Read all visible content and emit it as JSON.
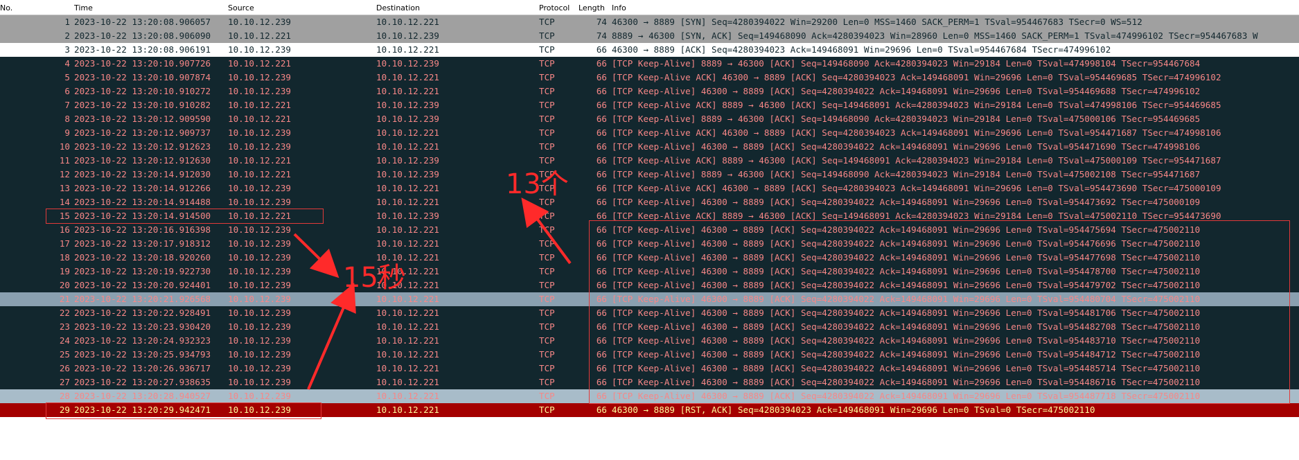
{
  "columns": {
    "no": "No.",
    "time": "Time",
    "source": "Source",
    "destination": "Destination",
    "protocol": "Protocol",
    "length": "Length",
    "info": "Info"
  },
  "packets": [
    {
      "no": "1",
      "time": "2023-10-22 13:20:08.906057",
      "src": "10.10.12.239",
      "dst": "10.10.12.221",
      "proto": "TCP",
      "len": "74",
      "info": "46300 → 8889 [SYN] Seq=4280394022 Win=29200 Len=0 MSS=1460 SACK_PERM=1 TSval=954467683 TSecr=0 WS=512",
      "style": "syn"
    },
    {
      "no": "2",
      "time": "2023-10-22 13:20:08.906090",
      "src": "10.10.12.221",
      "dst": "10.10.12.239",
      "proto": "TCP",
      "len": "74",
      "info": "8889 → 46300 [SYN, ACK] Seq=149468090 Ack=4280394023 Win=28960 Len=0 MSS=1460 SACK_PERM=1 TSval=474996102 TSecr=954467683 W",
      "style": "syn"
    },
    {
      "no": "3",
      "time": "2023-10-22 13:20:08.906191",
      "src": "10.10.12.239",
      "dst": "10.10.12.221",
      "proto": "TCP",
      "len": "66",
      "info": "46300 → 8889 [ACK] Seq=4280394023 Ack=149468091 Win=29696 Len=0 TSval=954467684 TSecr=474996102",
      "style": "sel"
    },
    {
      "no": "4",
      "time": "2023-10-22 13:20:10.907726",
      "src": "10.10.12.221",
      "dst": "10.10.12.239",
      "proto": "TCP",
      "len": "66",
      "info": "[TCP Keep-Alive] 8889 → 46300 [ACK] Seq=149468090 Ack=4280394023 Win=29184 Len=0 TSval=474998104 TSecr=954467684",
      "style": "ka"
    },
    {
      "no": "5",
      "time": "2023-10-22 13:20:10.907874",
      "src": "10.10.12.239",
      "dst": "10.10.12.221",
      "proto": "TCP",
      "len": "66",
      "info": "[TCP Keep-Alive ACK] 46300 → 8889 [ACK] Seq=4280394023 Ack=149468091 Win=29696 Len=0 TSval=954469685 TSecr=474996102",
      "style": "ka"
    },
    {
      "no": "6",
      "time": "2023-10-22 13:20:10.910272",
      "src": "10.10.12.239",
      "dst": "10.10.12.221",
      "proto": "TCP",
      "len": "66",
      "info": "[TCP Keep-Alive] 46300 → 8889 [ACK] Seq=4280394022 Ack=149468091 Win=29696 Len=0 TSval=954469688 TSecr=474996102",
      "style": "ka"
    },
    {
      "no": "7",
      "time": "2023-10-22 13:20:10.910282",
      "src": "10.10.12.221",
      "dst": "10.10.12.239",
      "proto": "TCP",
      "len": "66",
      "info": "[TCP Keep-Alive ACK] 8889 → 46300 [ACK] Seq=149468091 Ack=4280394023 Win=29184 Len=0 TSval=474998106 TSecr=954469685",
      "style": "ka"
    },
    {
      "no": "8",
      "time": "2023-10-22 13:20:12.909590",
      "src": "10.10.12.221",
      "dst": "10.10.12.239",
      "proto": "TCP",
      "len": "66",
      "info": "[TCP Keep-Alive] 8889 → 46300 [ACK] Seq=149468090 Ack=4280394023 Win=29184 Len=0 TSval=475000106 TSecr=954469685",
      "style": "ka"
    },
    {
      "no": "9",
      "time": "2023-10-22 13:20:12.909737",
      "src": "10.10.12.239",
      "dst": "10.10.12.221",
      "proto": "TCP",
      "len": "66",
      "info": "[TCP Keep-Alive ACK] 46300 → 8889 [ACK] Seq=4280394023 Ack=149468091 Win=29696 Len=0 TSval=954471687 TSecr=474998106",
      "style": "ka"
    },
    {
      "no": "10",
      "time": "2023-10-22 13:20:12.912623",
      "src": "10.10.12.239",
      "dst": "10.10.12.221",
      "proto": "TCP",
      "len": "66",
      "info": "[TCP Keep-Alive] 46300 → 8889 [ACK] Seq=4280394022 Ack=149468091 Win=29696 Len=0 TSval=954471690 TSecr=474998106",
      "style": "ka"
    },
    {
      "no": "11",
      "time": "2023-10-22 13:20:12.912630",
      "src": "10.10.12.221",
      "dst": "10.10.12.239",
      "proto": "TCP",
      "len": "66",
      "info": "[TCP Keep-Alive ACK] 8889 → 46300 [ACK] Seq=149468091 Ack=4280394023 Win=29184 Len=0 TSval=475000109 TSecr=954471687",
      "style": "ka"
    },
    {
      "no": "12",
      "time": "2023-10-22 13:20:14.912030",
      "src": "10.10.12.221",
      "dst": "10.10.12.239",
      "proto": "TCP",
      "len": "66",
      "info": "[TCP Keep-Alive] 8889 → 46300 [ACK] Seq=149468090 Ack=4280394023 Win=29184 Len=0 TSval=475002108 TSecr=954471687",
      "style": "ka"
    },
    {
      "no": "13",
      "time": "2023-10-22 13:20:14.912266",
      "src": "10.10.12.239",
      "dst": "10.10.12.221",
      "proto": "TCP",
      "len": "66",
      "info": "[TCP Keep-Alive ACK] 46300 → 8889 [ACK] Seq=4280394023 Ack=149468091 Win=29696 Len=0 TSval=954473690 TSecr=475000109",
      "style": "ka"
    },
    {
      "no": "14",
      "time": "2023-10-22 13:20:14.914488",
      "src": "10.10.12.239",
      "dst": "10.10.12.221",
      "proto": "TCP",
      "len": "66",
      "info": "[TCP Keep-Alive] 46300 → 8889 [ACK] Seq=4280394022 Ack=149468091 Win=29696 Len=0 TSval=954473692 TSecr=475000109",
      "style": "ka"
    },
    {
      "no": "15",
      "time": "2023-10-22 13:20:14.914500",
      "src": "10.10.12.221",
      "dst": "10.10.12.239",
      "proto": "TCP",
      "len": "66",
      "info": "[TCP Keep-Alive ACK] 8889 → 46300 [ACK] Seq=149468091 Ack=4280394023 Win=29184 Len=0 TSval=475002110 TSecr=954473690",
      "style": "ka"
    },
    {
      "no": "16",
      "time": "2023-10-22 13:20:16.916398",
      "src": "10.10.12.239",
      "dst": "10.10.12.221",
      "proto": "TCP",
      "len": "66",
      "info": "[TCP Keep-Alive] 46300 → 8889 [ACK] Seq=4280394022 Ack=149468091 Win=29696 Len=0 TSval=954475694 TSecr=475002110",
      "style": "ka"
    },
    {
      "no": "17",
      "time": "2023-10-22 13:20:17.918312",
      "src": "10.10.12.239",
      "dst": "10.10.12.221",
      "proto": "TCP",
      "len": "66",
      "info": "[TCP Keep-Alive] 46300 → 8889 [ACK] Seq=4280394022 Ack=149468091 Win=29696 Len=0 TSval=954476696 TSecr=475002110",
      "style": "ka"
    },
    {
      "no": "18",
      "time": "2023-10-22 13:20:18.920260",
      "src": "10.10.12.239",
      "dst": "10.10.12.221",
      "proto": "TCP",
      "len": "66",
      "info": "[TCP Keep-Alive] 46300 → 8889 [ACK] Seq=4280394022 Ack=149468091 Win=29696 Len=0 TSval=954477698 TSecr=475002110",
      "style": "ka"
    },
    {
      "no": "19",
      "time": "2023-10-22 13:20:19.922730",
      "src": "10.10.12.239",
      "dst": "10.10.12.221",
      "proto": "TCP",
      "len": "66",
      "info": "[TCP Keep-Alive] 46300 → 8889 [ACK] Seq=4280394022 Ack=149468091 Win=29696 Len=0 TSval=954478700 TSecr=475002110",
      "style": "ka"
    },
    {
      "no": "20",
      "time": "2023-10-22 13:20:20.924401",
      "src": "10.10.12.239",
      "dst": "10.10.12.221",
      "proto": "TCP",
      "len": "66",
      "info": "[TCP Keep-Alive] 46300 → 8889 [ACK] Seq=4280394022 Ack=149468091 Win=29696 Len=0 TSval=954479702 TSecr=475002110",
      "style": "ka"
    },
    {
      "no": "21",
      "time": "2023-10-22 13:20:21.926568",
      "src": "10.10.12.239",
      "dst": "10.10.12.221",
      "proto": "TCP",
      "len": "66",
      "info": "[TCP Keep-Alive] 46300 → 8889 [ACK] Seq=4280394022 Ack=149468091 Win=29696 Len=0 TSval=954480704 TSecr=475002110",
      "style": "hl-mid"
    },
    {
      "no": "22",
      "time": "2023-10-22 13:20:22.928491",
      "src": "10.10.12.239",
      "dst": "10.10.12.221",
      "proto": "TCP",
      "len": "66",
      "info": "[TCP Keep-Alive] 46300 → 8889 [ACK] Seq=4280394022 Ack=149468091 Win=29696 Len=0 TSval=954481706 TSecr=475002110",
      "style": "ka"
    },
    {
      "no": "23",
      "time": "2023-10-22 13:20:23.930420",
      "src": "10.10.12.239",
      "dst": "10.10.12.221",
      "proto": "TCP",
      "len": "66",
      "info": "[TCP Keep-Alive] 46300 → 8889 [ACK] Seq=4280394022 Ack=149468091 Win=29696 Len=0 TSval=954482708 TSecr=475002110",
      "style": "ka"
    },
    {
      "no": "24",
      "time": "2023-10-22 13:20:24.932323",
      "src": "10.10.12.239",
      "dst": "10.10.12.221",
      "proto": "TCP",
      "len": "66",
      "info": "[TCP Keep-Alive] 46300 → 8889 [ACK] Seq=4280394022 Ack=149468091 Win=29696 Len=0 TSval=954483710 TSecr=475002110",
      "style": "ka"
    },
    {
      "no": "25",
      "time": "2023-10-22 13:20:25.934793",
      "src": "10.10.12.239",
      "dst": "10.10.12.221",
      "proto": "TCP",
      "len": "66",
      "info": "[TCP Keep-Alive] 46300 → 8889 [ACK] Seq=4280394022 Ack=149468091 Win=29696 Len=0 TSval=954484712 TSecr=475002110",
      "style": "ka"
    },
    {
      "no": "26",
      "time": "2023-10-22 13:20:26.936717",
      "src": "10.10.12.239",
      "dst": "10.10.12.221",
      "proto": "TCP",
      "len": "66",
      "info": "[TCP Keep-Alive] 46300 → 8889 [ACK] Seq=4280394022 Ack=149468091 Win=29696 Len=0 TSval=954485714 TSecr=475002110",
      "style": "ka"
    },
    {
      "no": "27",
      "time": "2023-10-22 13:20:27.938635",
      "src": "10.10.12.239",
      "dst": "10.10.12.221",
      "proto": "TCP",
      "len": "66",
      "info": "[TCP Keep-Alive] 46300 → 8889 [ACK] Seq=4280394022 Ack=149468091 Win=29696 Len=0 TSval=954486716 TSecr=475002110",
      "style": "ka"
    },
    {
      "no": "28",
      "time": "2023-10-22 13:20:28.940527",
      "src": "10.10.12.239",
      "dst": "10.10.12.221",
      "proto": "TCP",
      "len": "66",
      "info": "[TCP Keep-Alive] 46300 → 8889 [ACK] Seq=4280394022 Ack=149468091 Win=29696 Len=0 TSval=954487718 TSecr=475002110",
      "style": "hl-light"
    },
    {
      "no": "29",
      "time": "2023-10-22 13:20:29.942471",
      "src": "10.10.12.239",
      "dst": "10.10.12.221",
      "proto": "TCP",
      "len": "66",
      "info": "46300 → 8889 [RST, ACK] Seq=4280394023 Ack=149468091 Win=29696 Len=0 TSval=0 TSecr=475002110",
      "style": "rst"
    }
  ],
  "annotations": {
    "label_15s": "15秒",
    "label_13": "13个"
  },
  "colors": {
    "keepalive_bg": "#12272e",
    "keepalive_fg": "#f78787",
    "rst_bg": "#a40000",
    "rst_fg": "#fffc9c",
    "annotation": "#ff2a2a"
  }
}
